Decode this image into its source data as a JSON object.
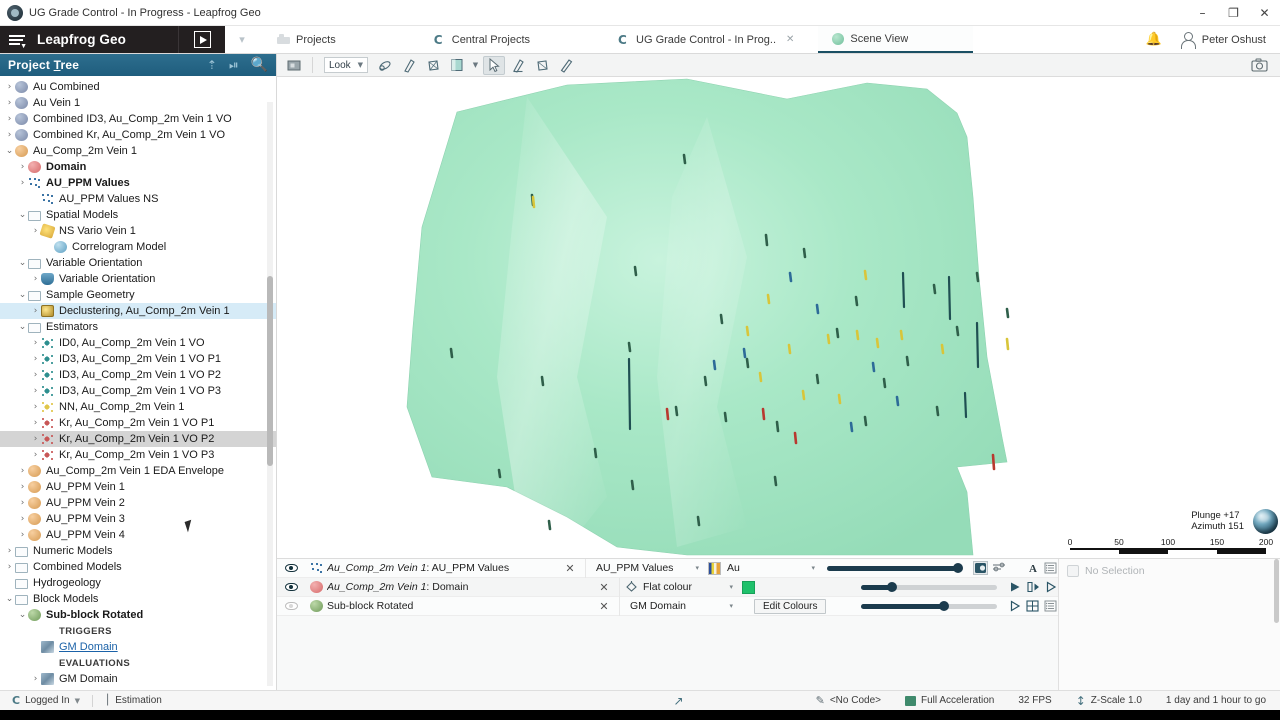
{
  "window": {
    "title": "UG Grade Control - In Progress - Leapfrog Geo",
    "app_icon": "leapfrog-logo-icon",
    "minimize": "–",
    "maximize": "❐",
    "close": "✕"
  },
  "header": {
    "brand": "Leapfrog Geo",
    "menu_icon": "hamburger-menu-icon",
    "play_icon": "play-icon",
    "chevron_icon": "▼",
    "notifications_icon": "✉",
    "user_name": "Peter Oshust",
    "user_icon": "user-avatar-icon",
    "tabs": [
      {
        "label": "Projects",
        "icon": "projects-icon",
        "active": false,
        "closable": false
      },
      {
        "label": "Central Projects",
        "icon": "central-icon",
        "active": false,
        "closable": false
      },
      {
        "label": "UG Grade Control - In Prog..",
        "icon": "central-icon",
        "active": false,
        "closable": true
      },
      {
        "label": "Scene View",
        "icon": "scene-sphere-icon",
        "active": true,
        "closable": false
      }
    ]
  },
  "project_tree": {
    "title_pre": "Project ",
    "title_underline": "T",
    "title_post": "ree",
    "icons": [
      "upload-icon",
      "pause-icon",
      "search-icon"
    ],
    "items": [
      {
        "label": "Au Combined",
        "depth": 1,
        "arrow": "›",
        "icon": "ic-sphere",
        "state": ""
      },
      {
        "label": "Au Vein 1",
        "depth": 1,
        "arrow": "›",
        "icon": "ic-sphere",
        "state": ""
      },
      {
        "label": "Combined ID3, Au_Comp_2m Vein 1 VO",
        "depth": 1,
        "arrow": "›",
        "icon": "ic-sphere",
        "state": ""
      },
      {
        "label": "Combined Kr, Au_Comp_2m Vein 1 VO",
        "depth": 1,
        "arrow": "›",
        "icon": "ic-sphere",
        "state": ""
      },
      {
        "label": "Au_Comp_2m Vein 1",
        "depth": 1,
        "arrow": "⌄",
        "icon": "ic-meshO",
        "state": ""
      },
      {
        "label": "Domain",
        "depth": 2,
        "arrow": "›",
        "icon": "ic-mesh",
        "state": "bold"
      },
      {
        "label": "AU_PPM Values",
        "depth": 2,
        "arrow": "›",
        "icon": "ic-pts",
        "state": "bold"
      },
      {
        "label": "AU_PPM Values NS",
        "depth": 3,
        "arrow": "",
        "icon": "ic-pts",
        "state": ""
      },
      {
        "label": "Spatial Models",
        "depth": 2,
        "arrow": "⌄",
        "icon": "ic-folder",
        "state": ""
      },
      {
        "label": "NS Vario Vein 1",
        "depth": 3,
        "arrow": "›",
        "icon": "ic-vario",
        "state": ""
      },
      {
        "label": "Correlogram Model",
        "depth": 4,
        "arrow": "",
        "icon": "ic-correl",
        "state": ""
      },
      {
        "label": "Variable Orientation",
        "depth": 2,
        "arrow": "⌄",
        "icon": "ic-folder",
        "state": ""
      },
      {
        "label": "Variable Orientation",
        "depth": 3,
        "arrow": "›",
        "icon": "ic-vo",
        "state": ""
      },
      {
        "label": "Sample Geometry",
        "depth": 2,
        "arrow": "⌄",
        "icon": "ic-folder",
        "state": ""
      },
      {
        "label": "Declustering, Au_Comp_2m Vein 1",
        "depth": 3,
        "arrow": "›",
        "icon": "ic-decl",
        "state": "sel"
      },
      {
        "label": "Estimators",
        "depth": 2,
        "arrow": "⌄",
        "icon": "ic-folder",
        "state": ""
      },
      {
        "label": "ID0, Au_Comp_2m Vein 1 VO",
        "depth": 3,
        "arrow": "›",
        "icon": "ic-est",
        "state": ""
      },
      {
        "label": "ID3, Au_Comp_2m Vein 1 VO P1",
        "depth": 3,
        "arrow": "›",
        "icon": "ic-est",
        "state": ""
      },
      {
        "label": "ID3, Au_Comp_2m Vein 1 VO P2",
        "depth": 3,
        "arrow": "›",
        "icon": "ic-est",
        "state": ""
      },
      {
        "label": "ID3, Au_Comp_2m Vein 1 VO P3",
        "depth": 3,
        "arrow": "›",
        "icon": "ic-est",
        "state": ""
      },
      {
        "label": "NN, Au_Comp_2m Vein 1",
        "depth": 3,
        "arrow": "›",
        "icon": "ic-nn",
        "state": ""
      },
      {
        "label": "Kr, Au_Comp_2m Vein 1 VO P1",
        "depth": 3,
        "arrow": "›",
        "icon": "ic-kr",
        "state": ""
      },
      {
        "label": "Kr, Au_Comp_2m Vein 1 VO P2",
        "depth": 3,
        "arrow": "›",
        "icon": "ic-kr",
        "state": "hover"
      },
      {
        "label": "Kr, Au_Comp_2m Vein 1 VO P3",
        "depth": 3,
        "arrow": "›",
        "icon": "ic-kr",
        "state": ""
      },
      {
        "label": "Au_Comp_2m Vein 1 EDA Envelope",
        "depth": 2,
        "arrow": "›",
        "icon": "ic-meshO",
        "state": ""
      },
      {
        "label": "AU_PPM Vein 1",
        "depth": 2,
        "arrow": "›",
        "icon": "ic-meshO",
        "state": ""
      },
      {
        "label": "AU_PPM Vein 2",
        "depth": 2,
        "arrow": "›",
        "icon": "ic-meshO",
        "state": ""
      },
      {
        "label": "AU_PPM Vein 3",
        "depth": 2,
        "arrow": "›",
        "icon": "ic-meshO",
        "state": ""
      },
      {
        "label": "AU_PPM Vein 4",
        "depth": 2,
        "arrow": "›",
        "icon": "ic-meshO",
        "state": ""
      },
      {
        "label": "Numeric Models",
        "depth": 1,
        "arrow": "›",
        "icon": "ic-folder",
        "state": ""
      },
      {
        "label": "Combined Models",
        "depth": 1,
        "arrow": "›",
        "icon": "ic-folder",
        "state": ""
      },
      {
        "label": "Hydrogeology",
        "depth": 1,
        "arrow": "",
        "icon": "ic-folder",
        "state": ""
      },
      {
        "label": "Block Models",
        "depth": 1,
        "arrow": "⌄",
        "icon": "ic-folder",
        "state": ""
      },
      {
        "label": "Sub-block Rotated",
        "depth": 2,
        "arrow": "⌄",
        "icon": "ic-block",
        "state": "bold"
      },
      {
        "label": "TRIGGERS",
        "depth": 3,
        "arrow": "",
        "icon": "none",
        "state": "caps"
      },
      {
        "label": "GM Domain",
        "depth": 3,
        "arrow": "",
        "icon": "ic-gmdom",
        "state": "link"
      },
      {
        "label": "EVALUATIONS",
        "depth": 3,
        "arrow": "",
        "icon": "none",
        "state": "caps"
      },
      {
        "label": "GM Domain",
        "depth": 3,
        "arrow": "›",
        "icon": "ic-gmdom",
        "state": ""
      }
    ]
  },
  "scene_toolbar": {
    "buttons": [
      {
        "name": "scene-settings-icon",
        "glyph": "▤"
      },
      {
        "name": "look-direction-select",
        "label": "Look",
        "caret": "▾"
      },
      {
        "name": "orbit-icon",
        "glyph": "⟳"
      },
      {
        "name": "pan-icon",
        "glyph": "⬌"
      },
      {
        "name": "zoom-box-icon",
        "glyph": "⧉"
      },
      {
        "name": "clipping-plane-icon",
        "glyph": "▧"
      },
      {
        "name": "clipping-dropdown-icon",
        "glyph": "▾"
      },
      {
        "name": "select-pointer-icon",
        "glyph": "➤"
      },
      {
        "name": "draw-polyline-icon",
        "glyph": "✐"
      },
      {
        "name": "draw-polygon-icon",
        "glyph": "⬠"
      },
      {
        "name": "measure-icon",
        "glyph": "╱"
      }
    ],
    "camera_icon": "camera-snapshot-icon"
  },
  "viewport": {
    "plunge": "Plunge +17",
    "azimuth": "Azimuth 151",
    "orientation_globe": "orientation-globe-icon",
    "scale_labels": [
      "0",
      "50",
      "100",
      "150",
      "200"
    ]
  },
  "shape_list": {
    "rows": [
      {
        "visible": true,
        "object_italic": "Au_Comp_2m Vein 1",
        "object_plain": ": AU_PPM Values",
        "object_icon": "points-icon",
        "remove": "✕",
        "attribute": "AU_PPM Values",
        "attribute_icon": "points-icon",
        "attribute_caret": "▾",
        "colour_kind": "ramp",
        "colour_label": "Au",
        "colour_caret": "▾",
        "slider_pct": 96,
        "tools": [
          "legend-box-icon",
          "filter-icon",
          "text-label-icon",
          "list-icon"
        ]
      },
      {
        "visible": true,
        "object_italic": "Au_Comp_2m Vein 1",
        "object_plain": ": Domain",
        "object_icon": "mesh-icon",
        "remove": "✕",
        "attribute": "Flat colour",
        "attribute_icon": "paint-bucket-icon",
        "attribute_caret": "▾",
        "colour_kind": "flat",
        "colour_label": "",
        "colour_caret": "",
        "slider_pct": 23,
        "tools": [
          "play-triangle-icon",
          "flip-icon",
          "outline-triangle-icon"
        ]
      },
      {
        "visible": false,
        "object_italic": "",
        "object_plain": "Sub-block Rotated",
        "object_icon": "block-model-icon",
        "remove": "✕",
        "attribute": "GM Domain",
        "attribute_icon": "gm-domain-icon",
        "attribute_caret": "▾",
        "colour_kind": "edit",
        "colour_label": "Edit Colours",
        "colour_caret": "",
        "slider_pct": 61,
        "tools": [
          "outline-triangle-icon",
          "grid-icon",
          "list-icon"
        ]
      }
    ],
    "no_selection": "No Selection",
    "no_selection_icon": "selection-icon"
  },
  "status_bar": {
    "login_icon": "central-connect-icon",
    "login_text": "Logged In",
    "login_caret": "▾",
    "workflow_icon": "workflow-icon",
    "workflow_text": "Estimation",
    "axes_icon": "axes-icon",
    "code_icon": "pencil-icon",
    "code_text": "<No Code>",
    "acceleration_icon": "acceleration-icon",
    "acceleration_text": "Full Acceleration",
    "fps_text": "32 FPS",
    "zscale_icon": "zscale-icon",
    "zscale_text": "Z-Scale 1.0",
    "expiry_text": "1 day and 1 hour to go"
  },
  "colors": {
    "brand_dark": "#231f20",
    "tree_header": "#235f80",
    "tab_active_underline": "#1a4f63",
    "surface_green": "#9fe3c0",
    "selection_blue": "#d6ebf7",
    "slider_dark": "#1b3b4d"
  }
}
